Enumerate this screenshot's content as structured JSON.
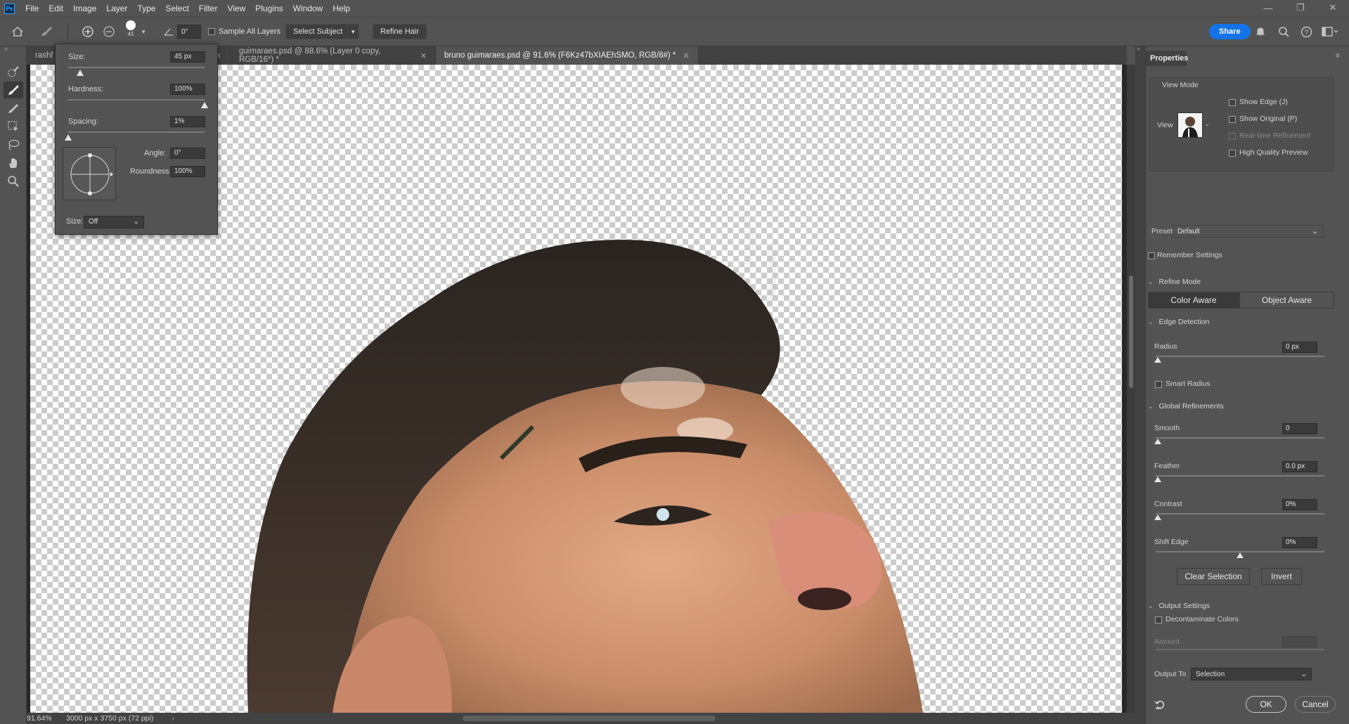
{
  "app": {
    "logo": "Ps"
  },
  "menu": [
    "File",
    "Edit",
    "Image",
    "Layer",
    "Type",
    "Select",
    "Filter",
    "View",
    "Plugins",
    "Window",
    "Help"
  ],
  "options": {
    "brush_size_label": "45",
    "angle_value": "0°",
    "sample_all_layers": "Sample All Layers",
    "select_subject": "Select Subject",
    "refine_hair": "Refine Hair",
    "share": "Share"
  },
  "tabs": [
    {
      "label": "rashf",
      "active": false
    },
    {
      "label": "guimaraes.psd @ 88.6% (Layer 0 copy, RGB/16*) *",
      "active": false
    },
    {
      "label": "bruno guimaraes.psd @ 91.6% (F6Kz47bXIAEhSMO, RGB/8#) *",
      "active": true
    }
  ],
  "brush_popup": {
    "size_label": "Size:",
    "size_value": "45 px",
    "size_level": 0.09,
    "hardness_label": "Hardness:",
    "hardness_value": "100%",
    "hardness_level": 1.0,
    "spacing_label": "Spacing:",
    "spacing_value": "1%",
    "spacing_level": 0.0,
    "angle_label": "Angle:",
    "angle_value": "0°",
    "roundness_label": "Roundness:",
    "roundness_value": "100%",
    "pressure_label": "Size:",
    "pressure_value": "Off"
  },
  "status": {
    "zoom": "91.64%",
    "doc_info": "3000 px x 3750 px (72 ppi)"
  },
  "properties": {
    "tab_title": "Properties",
    "view_mode_title": "View Mode",
    "view_label": "View",
    "show_edge": "Show Edge (J)",
    "show_original": "Show Original (P)",
    "realtime_refinement": "Real-time Refinement",
    "high_quality_preview": "High Quality Preview",
    "preset_label": "Preset",
    "preset_value": "Default",
    "remember_settings": "Remember Settings",
    "refine_mode_title": "Refine Mode",
    "color_aware": "Color Aware",
    "object_aware": "Object Aware",
    "edge_detection_title": "Edge Detection",
    "radius_label": "Radius",
    "radius_value": "0 px",
    "smart_radius": "Smart Radius",
    "global_refinements_title": "Global Refinements",
    "smooth_label": "Smooth",
    "smooth_value": "0",
    "feather_label": "Feather",
    "feather_value": "0.0 px",
    "contrast_label": "Contrast",
    "contrast_value": "0%",
    "shift_edge_label": "Shift Edge",
    "shift_edge_value": "0%",
    "clear_selection": "Clear Selection",
    "invert": "Invert",
    "output_settings_title": "Output Settings",
    "decontaminate_colors": "Decontaminate Colors",
    "amount_label": "Amount",
    "output_to_label": "Output To",
    "output_to_value": "Selection",
    "ok": "OK",
    "cancel": "Cancel"
  },
  "colors": {
    "accent": "#1473e6",
    "panel": "#535353",
    "canvas_bg": "#282828"
  },
  "icons": [
    "home-icon",
    "brush-tool-icon",
    "add-mode-icon",
    "subtract-mode-icon",
    "brush-preset-icon",
    "angle-icon",
    "bell-icon",
    "search-icon",
    "help-icon",
    "workspace-icon",
    "quick-selection-icon",
    "refine-edge-brush-icon",
    "brush-icon",
    "object-selection-icon",
    "lasso-icon",
    "hand-icon",
    "zoom-icon",
    "reset-icon"
  ]
}
